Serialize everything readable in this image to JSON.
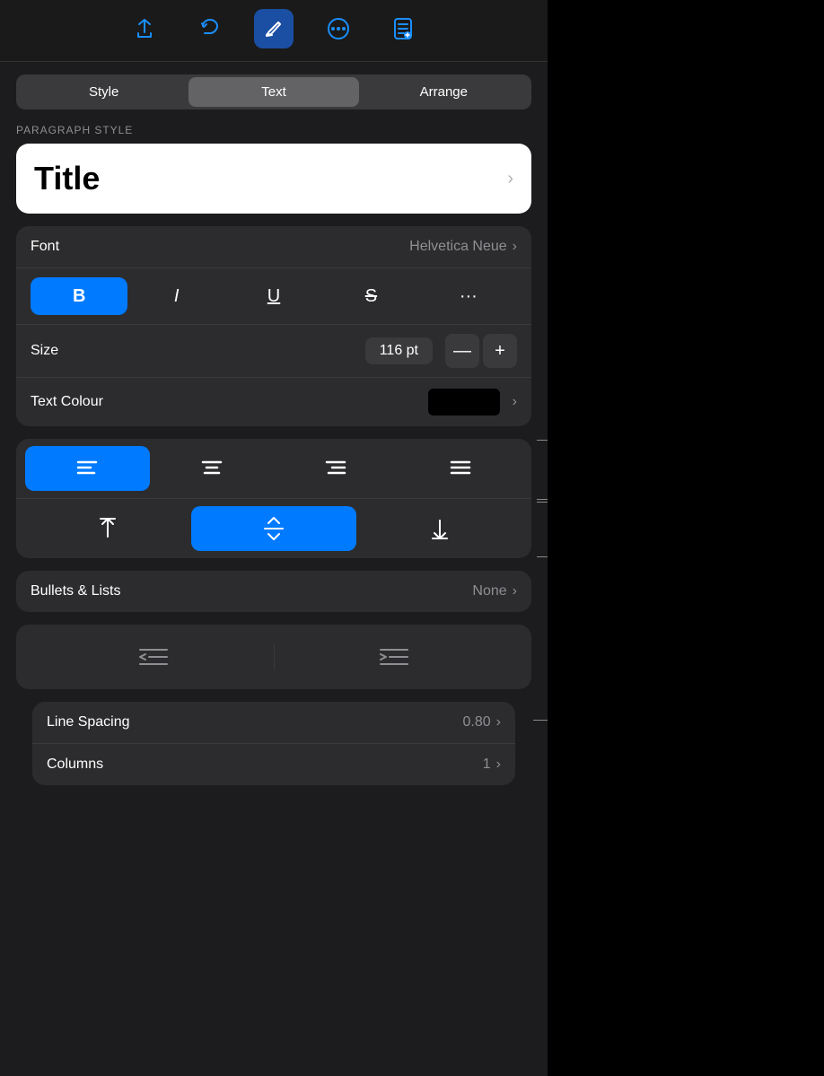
{
  "toolbar": {
    "buttons": [
      {
        "name": "share",
        "icon": "⬆",
        "active": false
      },
      {
        "name": "undo",
        "icon": "↩",
        "active": false
      },
      {
        "name": "markup",
        "icon": "✏",
        "active": true
      },
      {
        "name": "more",
        "icon": "···",
        "active": false
      },
      {
        "name": "doc",
        "icon": "📋",
        "active": false
      }
    ]
  },
  "tabs": {
    "items": [
      "Style",
      "Text",
      "Arrange"
    ],
    "active": "Text"
  },
  "section_label": "PARAGRAPH STYLE",
  "paragraph_style": {
    "value": "Title",
    "chevron": "›"
  },
  "font": {
    "label": "Font",
    "value": "Helvetica Neue",
    "chevron": "›"
  },
  "font_style": {
    "bold": "B",
    "italic": "I",
    "underline": "U",
    "strikethrough": "S",
    "more": "···"
  },
  "size": {
    "label": "Size",
    "value": "116 pt",
    "minus": "—",
    "plus": "+"
  },
  "text_colour": {
    "label": "Text Colour",
    "swatch": "#000000",
    "chevron": "›"
  },
  "alignment": {
    "horizontal": [
      {
        "name": "align-left",
        "icon": "≡",
        "active": true
      },
      {
        "name": "align-center",
        "icon": "≡",
        "active": false
      },
      {
        "name": "align-right",
        "icon": "≡",
        "active": false
      },
      {
        "name": "align-justify",
        "icon": "≡",
        "active": false
      }
    ],
    "vertical": [
      {
        "name": "valign-top",
        "icon": "⬆",
        "active": false
      },
      {
        "name": "valign-middle",
        "icon": "⤢",
        "active": true
      },
      {
        "name": "valign-bottom",
        "icon": "⬇",
        "active": false
      }
    ]
  },
  "bullets_lists": {
    "label": "Bullets & Lists",
    "value": "None",
    "chevron": "›"
  },
  "indent": {
    "decrease_icon": "◀≡",
    "increase_icon": "▶≡"
  },
  "line_spacing": {
    "label": "Line Spacing",
    "value": "0.80",
    "chevron": "›"
  },
  "columns": {
    "label": "Columns",
    "value": "1",
    "chevron": "›"
  }
}
